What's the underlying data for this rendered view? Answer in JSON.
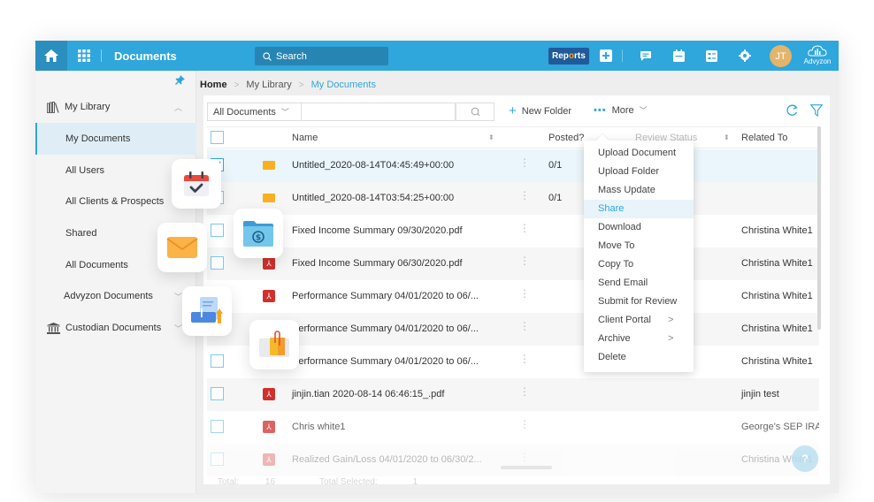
{
  "header": {
    "title": "Documents",
    "search_placeholder": "Search",
    "reports_label_a": "Rep",
    "reports_label_dot": "o",
    "reports_label_b": "rts",
    "avatar_initials": "JT",
    "brand": "Advyzon"
  },
  "colors": {
    "primary": "#2fa6dc",
    "header_dark": "#2a8fbf",
    "reports_bg": "#1f5a9a",
    "folder": "#f8b022",
    "pdf": "#d0312d",
    "avatar": "#e3b46b"
  },
  "sidebar": {
    "items": [
      {
        "label": "My Library",
        "icon": "library-icon",
        "expanded": true
      },
      {
        "label": "My Documents",
        "active": true
      },
      {
        "label": "All Users"
      },
      {
        "label": "All Clients & Prospects"
      },
      {
        "label": "Shared"
      },
      {
        "label": "All Documents"
      },
      {
        "label": "Advyzon Documents",
        "expandable": true
      },
      {
        "label": "Custodian Documents",
        "icon": "bank-icon",
        "expandable": true
      }
    ]
  },
  "breadcrumb": {
    "home": "Home",
    "middle": "My Library",
    "current": "My Documents"
  },
  "toolbar": {
    "filter_value": "All Documents",
    "search_value": "",
    "new_folder_label": "New Folder",
    "more_label": "More"
  },
  "table": {
    "columns": {
      "name": "Name",
      "posted": "Posted?",
      "review_status": "Review Status",
      "related_to": "Related To"
    },
    "rows": [
      {
        "type": "folder",
        "name": "Untitled_2020-08-14T04:45:49+00:00",
        "posted": "0/1",
        "related": "",
        "checked": true
      },
      {
        "type": "folder",
        "name": "Untitled_2020-08-14T03:54:25+00:00",
        "posted": "0/1",
        "related": ""
      },
      {
        "type": "pdf",
        "name": "Fixed Income Summary 09/30/2020.pdf",
        "posted": "",
        "related": "Christina White1"
      },
      {
        "type": "pdf",
        "name": "Fixed Income Summary 06/30/2020.pdf",
        "posted": "",
        "related": "Christina White1"
      },
      {
        "type": "pdf",
        "name": "Performance Summary 04/01/2020 to 06/...",
        "posted": "",
        "related": "Christina White1"
      },
      {
        "type": "pdf",
        "name": "Performance Summary 04/01/2020 to 06/...",
        "posted": "",
        "related": "Christina White1"
      },
      {
        "type": "pdf",
        "name": "Performance Summary 04/01/2020 to 06/...",
        "posted": "",
        "related": "Christina White1"
      },
      {
        "type": "pdf",
        "name": "jinjin.tian 2020-08-14 06:46:15_.pdf",
        "posted": "",
        "related": "jinjin test"
      },
      {
        "type": "pdf",
        "name": "Chris white1",
        "posted": "",
        "related": "George's SEP IRA"
      },
      {
        "type": "pdf",
        "name": "Realized Gain/Loss 04/01/2020 to 06/30/2...",
        "posted": "",
        "related": "Christina White1"
      }
    ]
  },
  "more_menu": {
    "items": [
      {
        "label": "Upload Document"
      },
      {
        "label": "Upload Folder"
      },
      {
        "label": "Mass Update"
      },
      {
        "label": "Share",
        "highlighted": true
      },
      {
        "label": "Download"
      },
      {
        "label": "Move To"
      },
      {
        "label": "Copy To"
      },
      {
        "label": "Send Email"
      },
      {
        "label": "Submit for Review"
      },
      {
        "label": "Client Portal",
        "submenu": true
      },
      {
        "label": "Archive",
        "submenu": true
      },
      {
        "label": "Delete"
      }
    ]
  },
  "footer": {
    "total_label": "Total:",
    "total_value": "16",
    "selected_label": "Total Selected:",
    "selected_value": "1"
  },
  "help_label": "?",
  "submenu_glyph": ">"
}
